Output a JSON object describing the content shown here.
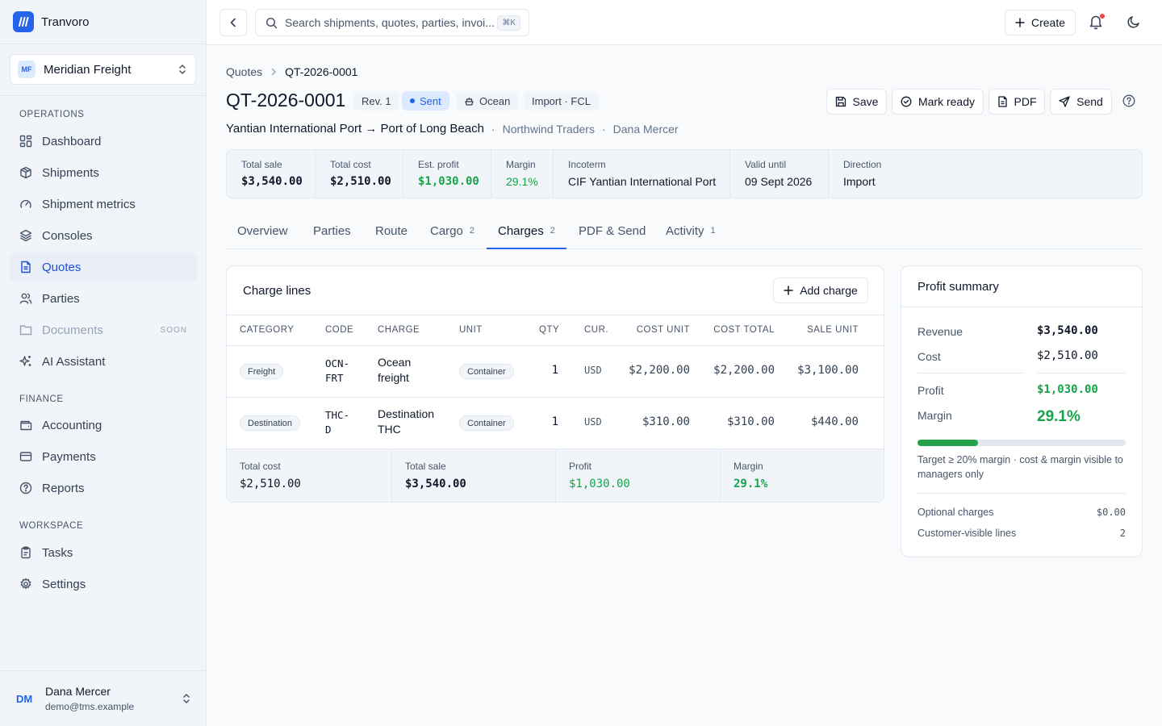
{
  "brand": {
    "name": "Tranvoro"
  },
  "org": {
    "initials": "MF",
    "name": "Meridian Freight"
  },
  "sidebar": {
    "sections": [
      "OPERATIONS",
      "FINANCE",
      "WORKSPACE"
    ],
    "items": [
      {
        "label": "Dashboard",
        "icon": "dashboard-icon"
      },
      {
        "label": "Shipments",
        "icon": "box-icon"
      },
      {
        "label": "Shipment metrics",
        "icon": "gauge-icon"
      },
      {
        "label": "Consoles",
        "icon": "layers-icon"
      },
      {
        "label": "Quotes",
        "icon": "file-text-icon",
        "active": true
      },
      {
        "label": "Parties",
        "icon": "users-icon"
      },
      {
        "label": "Documents",
        "icon": "folder-icon",
        "badge": "SOON"
      },
      {
        "label": "AI Assistant",
        "icon": "sparkles-icon"
      },
      {
        "label": "Accounting",
        "icon": "wallet-icon"
      },
      {
        "label": "Payments",
        "icon": "credit-card-icon"
      },
      {
        "label": "Reports",
        "icon": "help-circle-icon"
      },
      {
        "label": "Tasks",
        "icon": "clipboard-icon"
      },
      {
        "label": "Settings",
        "icon": "gear-icon"
      }
    ]
  },
  "user": {
    "initials": "DM",
    "name": "Dana Mercer",
    "email": "demo@tms.example"
  },
  "topbar": {
    "search_placeholder": "Search shipments, quotes, parties, invoi...",
    "shortcut": "⌘K",
    "create_label": "Create"
  },
  "breadcrumb": {
    "parent": "Quotes",
    "current": "QT-2026-0001"
  },
  "quote": {
    "id": "QT-2026-0001",
    "revision": "Rev. 1",
    "status": "Sent",
    "mode": "Ocean",
    "type": "Import · FCL",
    "route": "Yantian International Port → Port of Long Beach",
    "customer": "Northwind Traders",
    "owner": "Dana Mercer"
  },
  "actions": {
    "save": "Save",
    "mark_ready": "Mark ready",
    "pdf": "PDF",
    "send": "Send"
  },
  "stats": [
    {
      "label": "Total sale",
      "value": "$3,540.00"
    },
    {
      "label": "Total cost",
      "value": "$2,510.00"
    },
    {
      "label": "Est. profit",
      "value": "$1,030.00"
    },
    {
      "label": "Margin",
      "value": "29.1%"
    },
    {
      "label": "Incoterm",
      "value": "CIF Yantian International Port"
    },
    {
      "label": "Valid until",
      "value": "09 Sept 2026"
    },
    {
      "label": "Direction",
      "value": "Import"
    }
  ],
  "tabs": [
    {
      "label": "Overview",
      "count": ""
    },
    {
      "label": "Parties",
      "count": ""
    },
    {
      "label": "Route",
      "count": ""
    },
    {
      "label": "Cargo",
      "count": "2"
    },
    {
      "label": "Charges",
      "count": "2",
      "active": true
    },
    {
      "label": "PDF & Send",
      "count": ""
    },
    {
      "label": "Activity",
      "count": "1"
    }
  ],
  "charges": {
    "title": "Charge lines",
    "add_label": "Add charge",
    "columns": [
      "CATEGORY",
      "CODE",
      "CHARGE",
      "UNIT",
      "QTY",
      "CUR.",
      "COST UNIT",
      "COST TOTAL",
      "SALE UNIT"
    ],
    "rows": [
      {
        "category": "Freight",
        "code1": "OCN-",
        "code2": "FRT",
        "charge1": "Ocean",
        "charge2": "freight",
        "unit": "Container",
        "qty": "1",
        "cur": "USD",
        "cost_unit": "$2,200.00",
        "cost_total": "$2,200.00",
        "sale_unit": "$3,100.00"
      },
      {
        "category": "Destination",
        "code1": "THC-",
        "code2": "D",
        "charge1": "Destination",
        "charge2": "THC",
        "unit": "Container",
        "qty": "1",
        "cur": "USD",
        "cost_unit": "$310.00",
        "cost_total": "$310.00",
        "sale_unit": "$440.00"
      }
    ],
    "totals": [
      {
        "label": "Total cost",
        "value": "$2,510.00"
      },
      {
        "label": "Total sale",
        "value": "$3,540.00"
      },
      {
        "label": "Profit",
        "value": "$1,030.00"
      },
      {
        "label": "Margin",
        "value": "29.1%"
      }
    ]
  },
  "profit": {
    "title": "Profit summary",
    "revenue_label": "Revenue",
    "revenue": "$3,540.00",
    "cost_label": "Cost",
    "cost": "$2,510.00",
    "profit_label": "Profit",
    "profit": "$1,030.00",
    "margin_label": "Margin",
    "margin": "29.1%",
    "margin_fraction": 0.291,
    "note": "Target ≥ 20% margin · cost & margin visible to managers only",
    "optional_label": "Optional charges",
    "optional_value": "$0.00",
    "visible_label": "Customer-visible lines",
    "visible_value": "2"
  },
  "colors": {
    "accent": "#2563eb",
    "profit": "#16a34a",
    "sidebar_bg": "#f1f5f9"
  }
}
